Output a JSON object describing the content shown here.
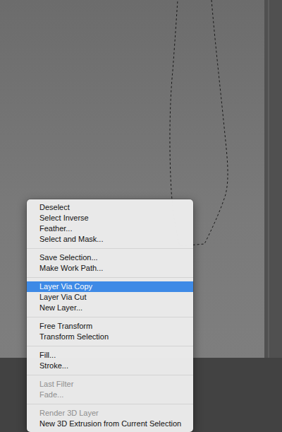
{
  "canvas": {
    "selection_active": true
  },
  "context_menu": {
    "groups": [
      {
        "items": [
          {
            "label": "Deselect",
            "selected": false,
            "disabled": false
          },
          {
            "label": "Select Inverse",
            "selected": false,
            "disabled": false
          },
          {
            "label": "Feather...",
            "selected": false,
            "disabled": false
          },
          {
            "label": "Select and Mask...",
            "selected": false,
            "disabled": false
          }
        ]
      },
      {
        "items": [
          {
            "label": "Save Selection...",
            "selected": false,
            "disabled": false
          },
          {
            "label": "Make Work Path...",
            "selected": false,
            "disabled": false
          }
        ]
      },
      {
        "items": [
          {
            "label": "Layer Via Copy",
            "selected": true,
            "disabled": false
          },
          {
            "label": "Layer Via Cut",
            "selected": false,
            "disabled": false
          },
          {
            "label": "New Layer...",
            "selected": false,
            "disabled": false
          }
        ]
      },
      {
        "items": [
          {
            "label": "Free Transform",
            "selected": false,
            "disabled": false
          },
          {
            "label": "Transform Selection",
            "selected": false,
            "disabled": false
          }
        ]
      },
      {
        "items": [
          {
            "label": "Fill...",
            "selected": false,
            "disabled": false
          },
          {
            "label": "Stroke...",
            "selected": false,
            "disabled": false
          }
        ]
      },
      {
        "items": [
          {
            "label": "Last Filter",
            "selected": false,
            "disabled": true
          },
          {
            "label": "Fade...",
            "selected": false,
            "disabled": true
          }
        ]
      },
      {
        "items": [
          {
            "label": "Render 3D Layer",
            "selected": false,
            "disabled": true
          },
          {
            "label": "New 3D Extrusion from Current Selection",
            "selected": false,
            "disabled": false
          }
        ]
      }
    ]
  }
}
